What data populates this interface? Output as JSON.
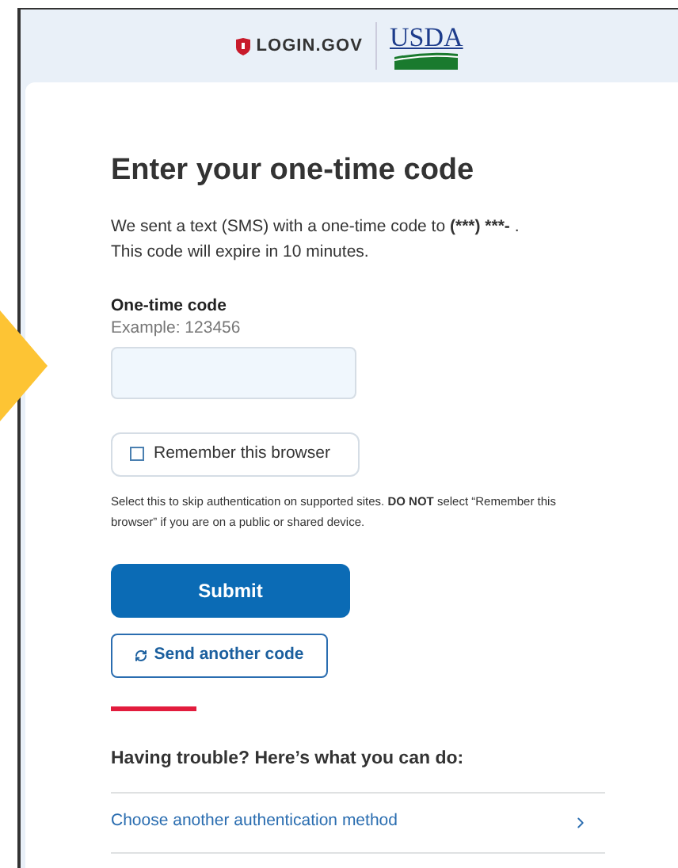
{
  "header": {
    "brand": "LOGIN.GOV",
    "partner": "USDA"
  },
  "title": "Enter your one-time code",
  "intro": "We sent a text (SMS) with a one-time code to",
  "phone": "(***) ***-",
  "intro_end": ".",
  "expiry": "This code will expire in 10 minutes.",
  "code_field": {
    "label": "One-time code",
    "hint": "Example: 123456"
  },
  "remember": {
    "label": "Remember this browser",
    "checked": false
  },
  "remember_help": "Select this to skip authentication on supported sites. **DO NOT** select “Remember this browser” if you are on a public or shared device.",
  "buttons": [
    {
      "kind": "primary",
      "label": "Submit"
    },
    {
      "kind": "resend",
      "label": "Send another code"
    }
  ],
  "trouble": {
    "heading": "Having trouble? Here’s what you can do:",
    "links": [
      "Choose another authentication method"
    ]
  }
}
